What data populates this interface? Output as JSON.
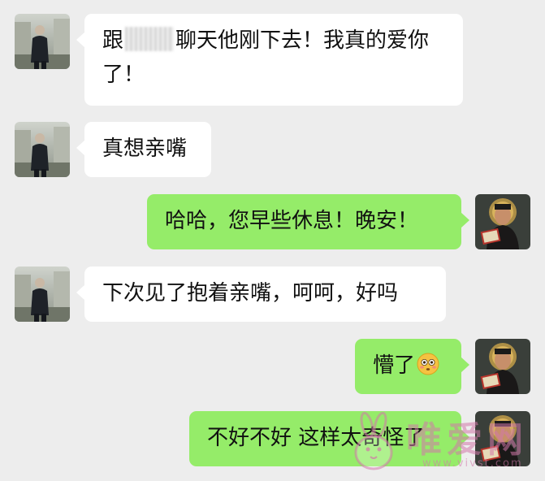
{
  "messages": [
    {
      "side": "in",
      "line1": "跟",
      "line1b": "聊天他刚下去！我真的爱你",
      "line2": "了！"
    },
    {
      "side": "in",
      "text": "真想亲嘴"
    },
    {
      "side": "out",
      "text": "哈哈，您早些休息！晚安！"
    },
    {
      "side": "in",
      "text": "下次见了抱着亲嘴，呵呵，好吗"
    },
    {
      "side": "out",
      "text": "懵了",
      "emoji": "flushed-face"
    },
    {
      "side": "out",
      "text": "不好不好 这样太奇怪了"
    }
  ],
  "watermark": {
    "brand": "唯爱网",
    "url": "www.vivst.com"
  },
  "colors": {
    "background": "#ededed",
    "incoming_bubble": "#ffffff",
    "outgoing_bubble": "#95ec69",
    "text": "#111111"
  }
}
